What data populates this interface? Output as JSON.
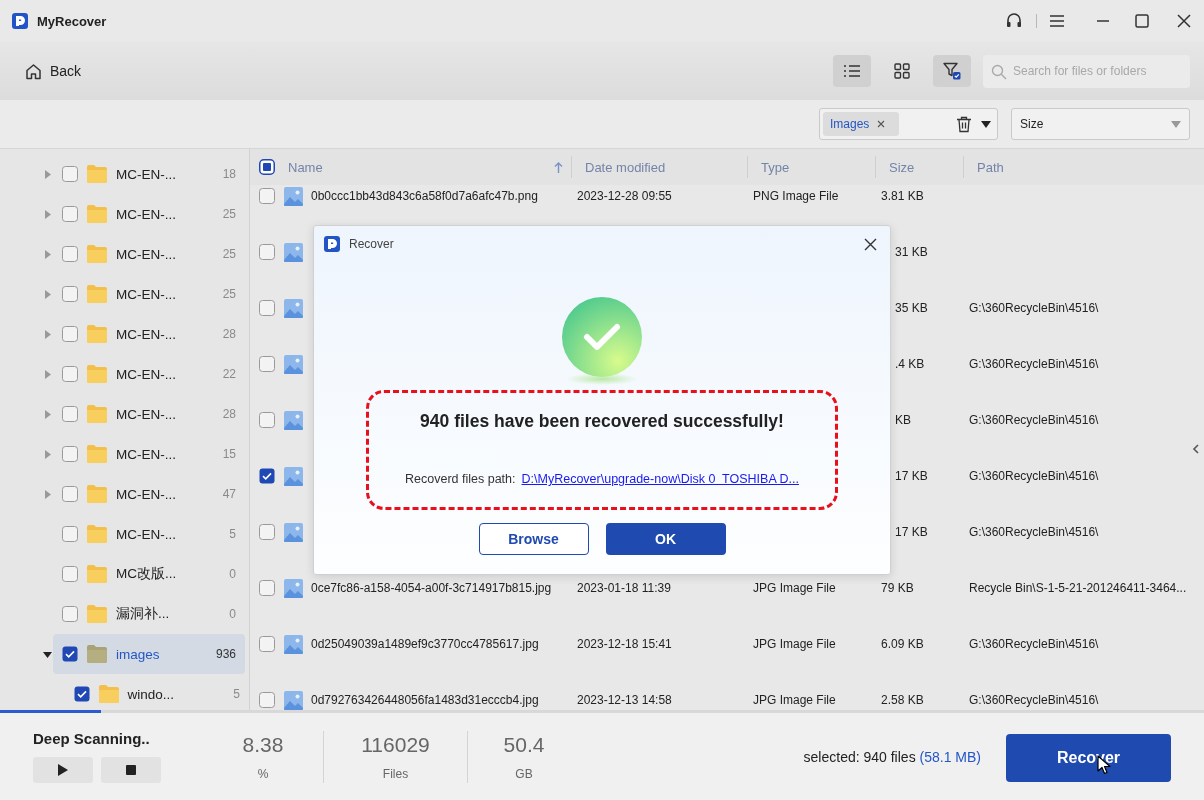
{
  "titlebar": {
    "app_name": "MyRecover"
  },
  "toolbar": {
    "back": "Back",
    "views": [
      {
        "kind": "list",
        "selected": true
      },
      {
        "kind": "grid",
        "selected": false
      },
      {
        "kind": "filter",
        "selected": true
      }
    ],
    "search": {
      "placeholder": "Search for files or folders"
    }
  },
  "filters": {
    "type_chip": "Images",
    "size": "Size"
  },
  "tree": [
    {
      "name": "MC-EN-...",
      "count": "18",
      "checked": false,
      "kind": "branch",
      "expanded": false,
      "selected": false
    },
    {
      "name": "MC-EN-...",
      "count": "25",
      "checked": false,
      "kind": "branch",
      "expanded": false,
      "selected": false
    },
    {
      "name": "MC-EN-...",
      "count": "25",
      "checked": false,
      "kind": "branch",
      "expanded": false,
      "selected": false
    },
    {
      "name": "MC-EN-...",
      "count": "25",
      "checked": false,
      "kind": "branch",
      "expanded": false,
      "selected": false
    },
    {
      "name": "MC-EN-...",
      "count": "28",
      "checked": false,
      "kind": "branch",
      "expanded": false,
      "selected": false
    },
    {
      "name": "MC-EN-...",
      "count": "22",
      "checked": false,
      "kind": "branch",
      "expanded": false,
      "selected": false
    },
    {
      "name": "MC-EN-...",
      "count": "28",
      "checked": false,
      "kind": "branch",
      "expanded": false,
      "selected": false
    },
    {
      "name": "MC-EN-...",
      "count": "15",
      "checked": false,
      "kind": "branch",
      "expanded": false,
      "selected": false
    },
    {
      "name": "MC-EN-...",
      "count": "47",
      "checked": false,
      "kind": "branch",
      "expanded": false,
      "selected": false
    },
    {
      "name": "MC-EN-...",
      "count": "5",
      "checked": false,
      "kind": "leaf",
      "expanded": false,
      "selected": false
    },
    {
      "name": "MC改版...",
      "count": "0",
      "checked": false,
      "kind": "leaf",
      "expanded": false,
      "selected": false
    },
    {
      "name": "漏洞补...",
      "count": "0",
      "checked": false,
      "kind": "leaf",
      "expanded": false,
      "selected": false
    },
    {
      "name": "images",
      "count": "936",
      "checked": true,
      "kind": "branch",
      "expanded": true,
      "selected": true,
      "children": [
        {
          "name": "windo...",
          "count": "5",
          "checked": true,
          "expanded": false,
          "selected": false
        }
      ]
    }
  ],
  "table": {
    "select_all": {
      "partial": true
    },
    "columns": [
      {
        "label": "Name",
        "sorted": true
      },
      {
        "label": "Date modified",
        "sorted": false
      },
      {
        "label": "Type",
        "sorted": false
      },
      {
        "label": "Size",
        "sorted": false
      },
      {
        "label": "Path",
        "sorted": false
      }
    ],
    "rows": [
      {
        "kind": "full",
        "checked": false,
        "name": "0b0ccc1bb43d843c6a58f0d7a6afc47b.png",
        "date": "2023-12-28 09:55",
        "type": "PNG Image File",
        "size": "3.81 KB"
      },
      {
        "kind": "covered",
        "checked": false,
        "size": "31 KB"
      },
      {
        "kind": "covered",
        "checked": false,
        "size": "35 KB",
        "path": "G:\\360RecycleBin\\4516\\"
      },
      {
        "kind": "covered",
        "checked": false,
        "size": ".4 KB",
        "path": "G:\\360RecycleBin\\4516\\"
      },
      {
        "kind": "covered",
        "checked": false,
        "size": "KB",
        "path": "G:\\360RecycleBin\\4516\\"
      },
      {
        "kind": "covered",
        "checked": true,
        "size": "17 KB",
        "path": "G:\\360RecycleBin\\4516\\"
      },
      {
        "kind": "covered",
        "checked": false,
        "size": "17 KB",
        "path": "G:\\360RecycleBin\\4516\\"
      },
      {
        "kind": "full",
        "checked": false,
        "name": "0ce7fc86-a158-4054-a00f-3c714917b815.jpg",
        "date": "2023-01-18 11:39",
        "type": "JPG Image File",
        "size": "79 KB",
        "path": "Recycle Bin\\S-1-5-21-201246411-3464..."
      },
      {
        "kind": "full",
        "checked": false,
        "name": "0d25049039a1489ef9c3770cc4785617.jpg",
        "date": "2023-12-18 15:41",
        "type": "JPG Image File",
        "size": "6.09 KB",
        "path": "G:\\360RecycleBin\\4516\\"
      },
      {
        "kind": "full",
        "checked": false,
        "name": "0d792763426448056fa1483d31ecccb4.jpg",
        "date": "2023-12-13 14:58",
        "type": "JPG Image File",
        "size": "2.58 KB",
        "path": "G:\\360RecycleBin\\4516\\"
      }
    ]
  },
  "dialog": {
    "title": "Recover",
    "message": "940 files have been recovered successfully!",
    "path_label": "Recoverd files path:",
    "path": "D:\\MyRecover\\upgrade-now\\Disk 0  TOSHIBA D...",
    "buttons": [
      {
        "label": "Browse",
        "kind": "secondary"
      },
      {
        "label": "OK",
        "kind": "primary"
      }
    ]
  },
  "status": {
    "title": "Deep Scanning..",
    "progress": {
      "level": 0.0838
    },
    "stats": [
      {
        "value": "8.38",
        "unit": "%"
      },
      {
        "value": "116029",
        "unit": "Files"
      },
      {
        "value": "50.4",
        "unit": "GB"
      }
    ],
    "selected_label": "selected: 940 files",
    "selected_size": "(58.1 MB)",
    "recover": "Recover"
  }
}
